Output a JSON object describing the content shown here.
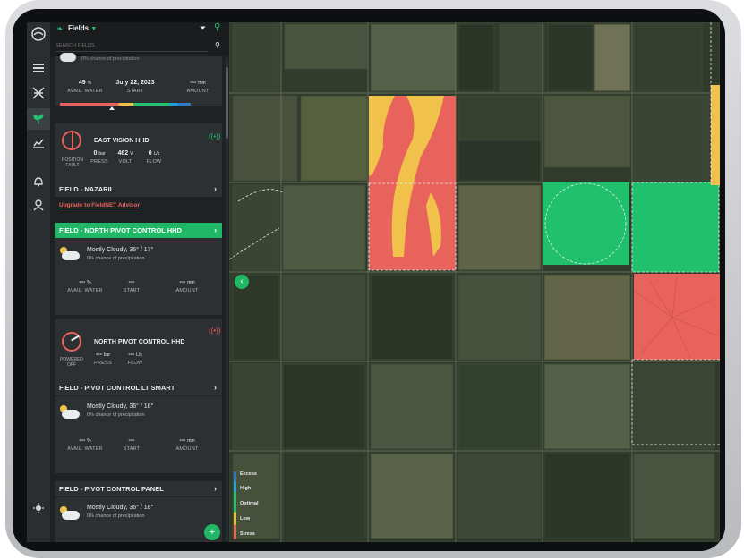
{
  "header": {
    "title": "Fields",
    "search_placeholder": "SEARCH FIELDS"
  },
  "top_card": {
    "cut_text": "0% chance of precipitation",
    "avail_water": "49",
    "avail_water_unit": "%",
    "avail_water_label": "AVAIL. WATER",
    "start": "July 22, 2023",
    "start_label": "START",
    "amount": "---",
    "amount_unit": "mm",
    "amount_label": "AMOUNT"
  },
  "east_vision": {
    "name": "EAST VISION HHD",
    "status_label": "POSITION FAULT",
    "press": "0",
    "press_unit": "bar",
    "press_label": "PRESS",
    "volt": "462",
    "volt_unit": "V",
    "volt_label": "VOLT",
    "flow": "0",
    "flow_unit": "L/s",
    "flow_label": "FLOW"
  },
  "field_nazarii": {
    "title": "FIELD - NAZARII",
    "upgrade_link": "Upgrade to FieldNET Advisor"
  },
  "field_north": {
    "title": "FIELD - NORTH PIVOT CONTROL HHD",
    "weather": "Mostly Cloudy, 36° / 17°",
    "precip": "0% chance of precipitation",
    "avail_water": "---",
    "avail_water_unit": "%",
    "avail_water_label": "AVAIL. WATER",
    "start": "---",
    "start_label": "START",
    "amount": "---",
    "amount_unit": "mm",
    "amount_label": "AMOUNT",
    "device_name": "NORTH PIVOT CONTROL HHD",
    "device_status": "POWERED OFF",
    "press": "---",
    "press_unit": "bar",
    "press_label": "PRESS",
    "flow": "---",
    "flow_unit": "L/s",
    "flow_label": "FLOW"
  },
  "field_lt": {
    "title": "FIELD - PIVOT CONTROL LT SMART",
    "weather": "Mostly Cloudy, 36° / 18°",
    "precip": "0% chance of precipitation",
    "avail_water": "---",
    "avail_water_unit": "%",
    "avail_water_label": "AVAIL. WATER",
    "start": "---",
    "start_label": "START",
    "amount": "---",
    "amount_unit": "mm",
    "amount_label": "AMOUNT"
  },
  "field_panel": {
    "title": "FIELD - PIVOT CONTROL PANEL",
    "weather": "Mostly Cloudy, 36° / 18°",
    "precip": "0% chance of precipitation"
  },
  "legend": [
    "Excess",
    "High",
    "Optimal",
    "Low",
    "Stress"
  ],
  "colors": {
    "accent": "#22c56d",
    "stress": "#e8635b",
    "low": "#f0c24b",
    "optimal": "#20c06d",
    "high": "#1fa3d6",
    "excess": "#2f79c6"
  }
}
